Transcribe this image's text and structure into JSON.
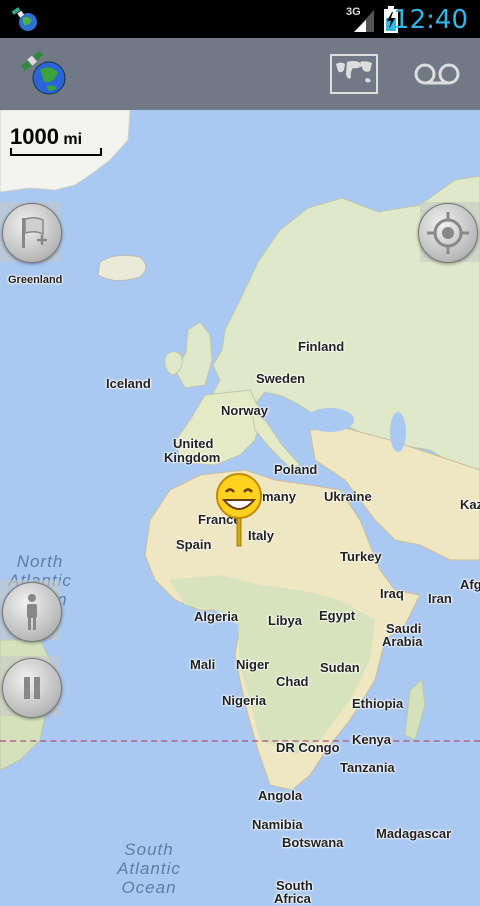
{
  "status_bar": {
    "network": "3G",
    "time": "12:40"
  },
  "toolbar": {
    "logo_icon": "satellite-globe-icon",
    "map_type_icon": "world-map-icon",
    "record_icon": "voicemail-tape-icon"
  },
  "map": {
    "scale": {
      "value": "1000",
      "unit": "mi"
    },
    "labels": {
      "greenland": "Greenland",
      "iceland": "Iceland",
      "finland": "Finland",
      "sweden": "Sweden",
      "norway": "Norway",
      "united_kingdom_1": "United",
      "united_kingdom_2": "Kingdom",
      "poland": "Poland",
      "germany": "many",
      "ukraine": "Ukraine",
      "kaz": "Kaz",
      "france": "France",
      "italy": "Italy",
      "spain": "Spain",
      "turkey": "Turkey",
      "afg": "Afg",
      "iraq": "Iraq",
      "iran": "Iran",
      "algeria": "Algeria",
      "libya": "Libya",
      "egypt": "Egypt",
      "saudi_1": "Saudi",
      "saudi_2": "Arabia",
      "mali": "Mali",
      "niger": "Niger",
      "sudan": "Sudan",
      "chad": "Chad",
      "nigeria": "Nigeria",
      "ethiopia": "Ethiopia",
      "dr_congo": "DR Congo",
      "kenya": "Kenya",
      "tanzania": "Tanzania",
      "angola": "Angola",
      "namibia": "Namibia",
      "botswana": "Botswana",
      "madagascar": "Madagascar",
      "south_africa_1": "South",
      "south_africa_2": "Africa"
    },
    "oceans": {
      "north_atlantic_1": "North",
      "north_atlantic_2": "Atlantic",
      "north_atlantic_3": "Ocean",
      "south_atlantic_1": "South",
      "south_atlantic_2": "Atlantic",
      "south_atlantic_3": "Ocean"
    },
    "controls": {
      "add_waypoint_icon": "flag-plus-icon",
      "my_location_icon": "crosshair-icon",
      "person_icon": "person-icon",
      "pause_icon": "pause-icon"
    },
    "marker_icon": "smiley-marker-icon"
  }
}
